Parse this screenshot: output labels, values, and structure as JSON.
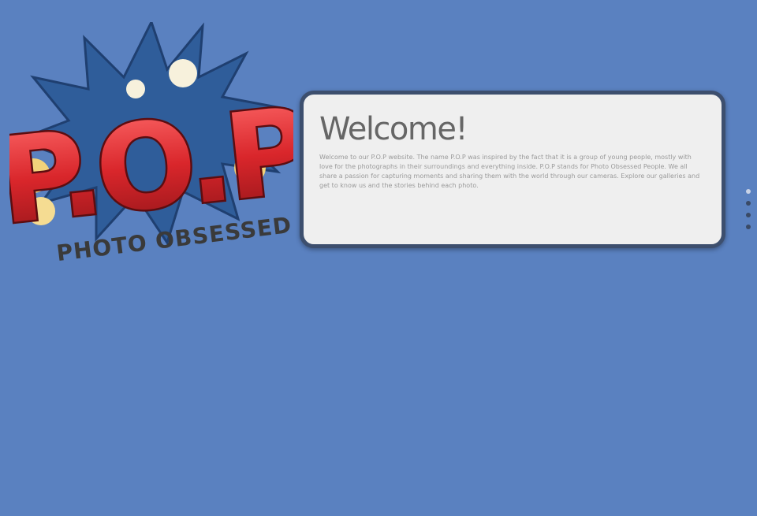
{
  "logo": {
    "main_text": "P.O.P",
    "sub_text": "PHOTO OBSESSED"
  },
  "welcome": {
    "title": "Welcome!",
    "body": "Welcome to our P.O.P website. The name P.O.P was inspired by the fact that it is a group of young people, mostly with love for the photographs in their surroundings and everything inside. P.O.P stands for Photo Obsessed People. We all share a passion for capturing moments and sharing them with the world through our cameras. Explore our galleries and get to know us and the stories behind each photo."
  },
  "pager": {
    "count": 4,
    "active_index": 0
  },
  "colors": {
    "background": "#5a81c0",
    "card_bg": "#efefef",
    "card_border": "#3d4f6e",
    "logo_red": "#d9262b",
    "logo_burst": "#2f5d9a",
    "logo_popcorn": "#f2d27a"
  }
}
